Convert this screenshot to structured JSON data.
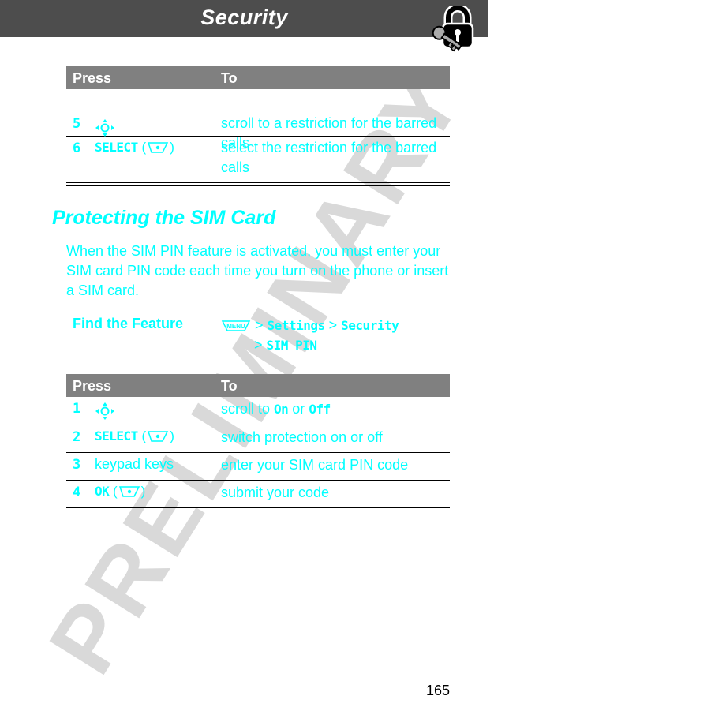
{
  "header": {
    "title": "Security",
    "icon": "lock-and-key-icon"
  },
  "watermark": "PRELIMINARY",
  "table1": {
    "columns": [
      "Press",
      "To"
    ],
    "rows": [
      {
        "num": "5",
        "key": "",
        "key_icon": "nav-key-icon",
        "desc": "scroll to a restriction for the barred calls"
      },
      {
        "num": "6",
        "key": "SELECT",
        "key_icon": "soft-key-icon",
        "desc": "select the restriction for the barred calls"
      }
    ]
  },
  "section": {
    "title": "Protecting the SIM Card",
    "body": "When the SIM PIN feature is activated, you must enter your SIM card PIN code each time you turn on the phone or insert a SIM card."
  },
  "find_feature": {
    "label": "Find the Feature",
    "menu_icon": "menu-key-icon",
    "sep": ">",
    "path": [
      "Settings",
      "Security",
      "SIM PIN"
    ]
  },
  "table2": {
    "columns": [
      "Press",
      "To"
    ],
    "rows": [
      {
        "num": "1",
        "key": "",
        "key_icon": "nav-key-icon",
        "desc_pre": "scroll to ",
        "desc_on": "On",
        "desc_mid": " or ",
        "desc_off": "Off"
      },
      {
        "num": "2",
        "key": "SELECT",
        "key_icon": "soft-key-icon",
        "desc": "switch protection on or off"
      },
      {
        "num": "3",
        "key": "keypad keys",
        "desc": "enter your SIM card PIN code"
      },
      {
        "num": "4",
        "key": "OK",
        "key_icon": "soft-key-icon",
        "desc": "submit your code"
      }
    ]
  },
  "page_number": "165"
}
